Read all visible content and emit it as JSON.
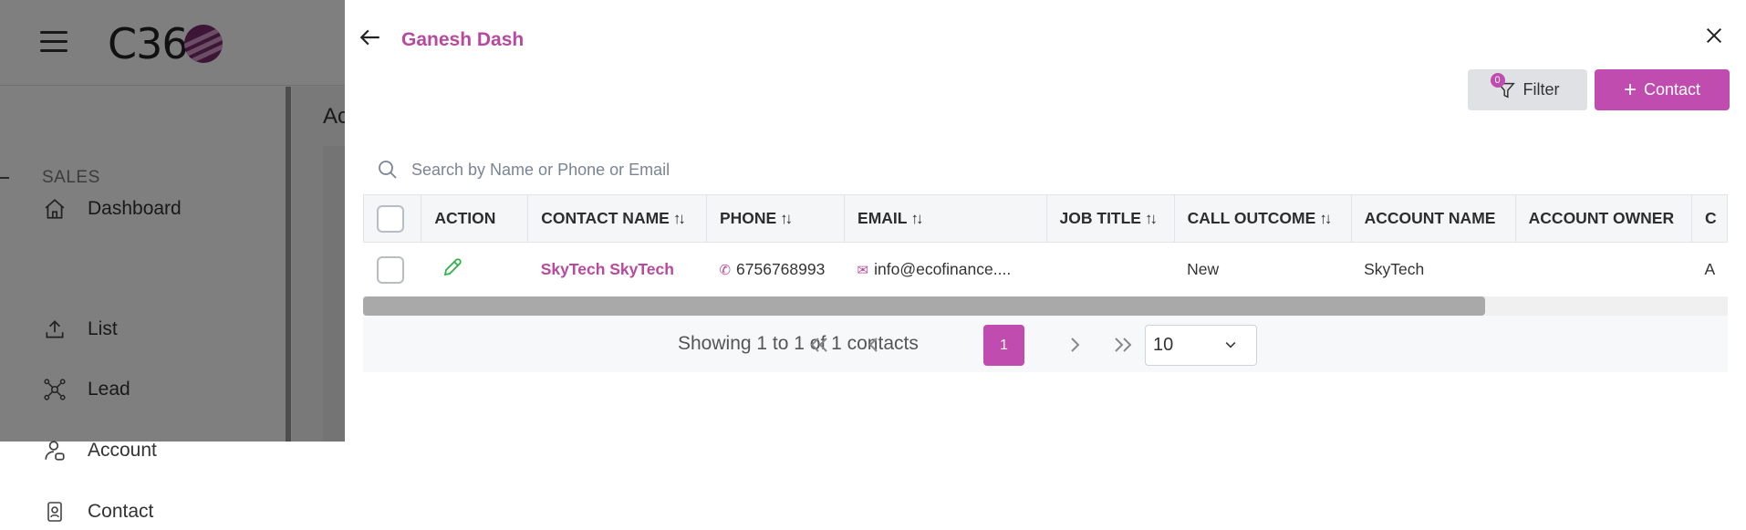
{
  "app": {
    "logo_text": "C36",
    "sidebar": {
      "dashboard": "Dashboard",
      "section": "SALES",
      "items": [
        "List",
        "Lead",
        "Account",
        "Contact"
      ]
    },
    "page_title_partial": "Ac"
  },
  "drawer": {
    "title": "Ganesh Dash",
    "filter": {
      "label": "Filter",
      "badge": "0"
    },
    "add_contact": {
      "label": "Contact"
    },
    "search": {
      "placeholder": "Search by Name or Phone or Email",
      "value": ""
    },
    "table": {
      "columns": [
        "ACTION",
        "CONTACT NAME",
        "PHONE",
        "EMAIL",
        "JOB TITLE",
        "CALL OUTCOME",
        "ACCOUNT NAME",
        "ACCOUNT OWNER",
        "C"
      ],
      "rows": [
        {
          "contact_name": "SkyTech SkyTech",
          "phone": "6756768993",
          "email": "info@ecofinance....",
          "job_title": "",
          "call_outcome": "New",
          "account_name": "SkyTech",
          "account_owner": "",
          "next_col": "A"
        }
      ]
    },
    "pagination": {
      "summary": "Showing 1 to 1 of 1 contacts",
      "current_page": "1",
      "page_size": "10"
    }
  },
  "colors": {
    "accent": "#c14cb0",
    "accent_text": "#b8499f",
    "overlay": "rgba(0,0,0,0.5)",
    "edit_icon": "#2db34a"
  }
}
